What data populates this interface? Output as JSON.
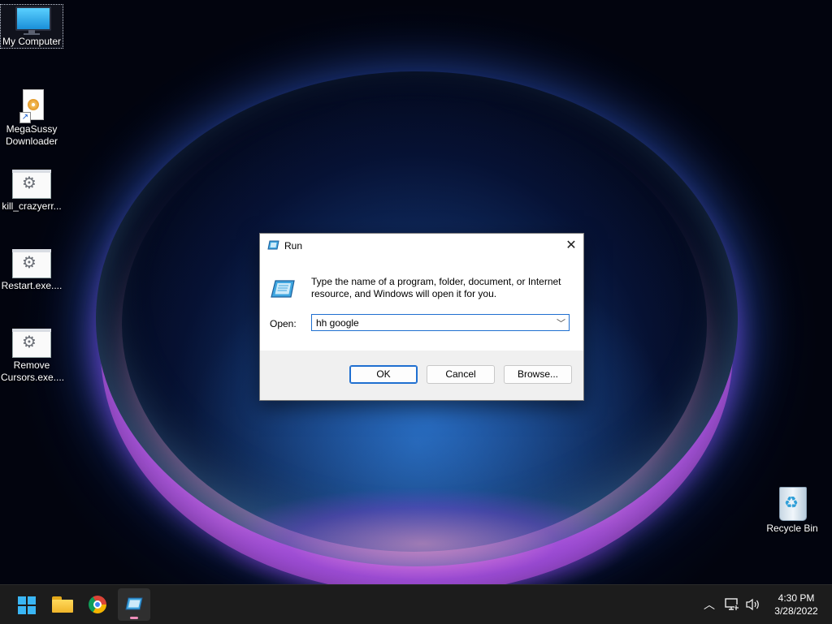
{
  "desktop": {
    "icons": [
      {
        "label": "My Computer"
      },
      {
        "label": "MegaSussy Downloader"
      },
      {
        "label": "kill_crazyerr..."
      },
      {
        "label": "Restart.exe...."
      },
      {
        "label": "Remove Cursors.exe...."
      },
      {
        "label": "Recycle Bin"
      }
    ]
  },
  "run_dialog": {
    "title": "Run",
    "message": "Type the name of a program, folder, document, or Internet resource, and Windows will open it for you.",
    "open_label": "Open:",
    "input_value": "hh google",
    "ok_label": "OK",
    "cancel_label": "Cancel",
    "browse_label": "Browse..."
  },
  "taskbar": {
    "apps": [
      "start-icon",
      "file-explorer-icon",
      "chrome-icon",
      "run-icon"
    ],
    "active_app": "run-icon",
    "tray_icons": [
      "chevron-up-icon",
      "network-icon",
      "volume-icon"
    ],
    "time": "4:30 PM",
    "date": "3/28/2022"
  },
  "colors": {
    "accent": "#1f6fd0",
    "taskbar_bg": "#1c1c1c",
    "active_indicator": "#ee8ebb"
  }
}
